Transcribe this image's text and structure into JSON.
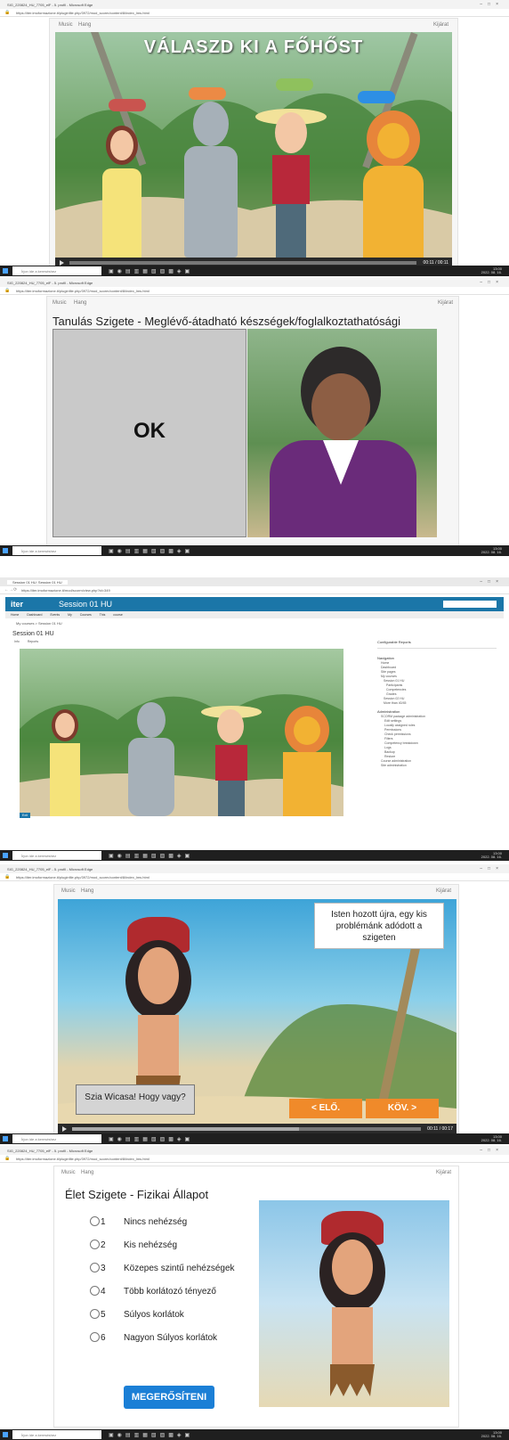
{
  "shot1": {
    "window_title": "SIG_220824_HU_7705_elF - 5. profil - Microsoft Edge",
    "url": "https://iter.imoformazione.it/pluginfile.php/3972/mod_scorm/content/8/index_lms.html",
    "menu_music": "Music",
    "menu_sound": "Hang",
    "exit": "Kijárat",
    "headline": "VÁLASZD KI A FŐHŐST",
    "time": "00:11 / 00:11"
  },
  "shot2": {
    "window_title": "SIG_220824_HU_7705_elF - 5. profil - Microsoft Edge",
    "url": "https://iter.imoformazione.it/pluginfile.php/3972/mod_scorm/content/8/index_lms.html",
    "menu_music": "Music",
    "menu_sound": "Hang",
    "exit": "Kijárat",
    "title": "Tanulás Szigete - Meglévő-átadható készségek/foglalkoztathatósági",
    "ok": "OK"
  },
  "shot3": {
    "tab_title": "Session 01 HU: Session 01 HU",
    "url": "https://iter.imoformazione.it/mod/scorm/view.php?id=349",
    "site_logo": "iter",
    "course_title": "Session 01 HU",
    "nav_items": [
      "Home",
      "Dashboard",
      "Events",
      "My Courses",
      "This course"
    ],
    "breadcrumb": "My courses  >  Session 01 HU",
    "page_heading": "Session 01 HU",
    "tabs": [
      "Info",
      "Reports"
    ],
    "block_reports": "Configurable Reports",
    "block_navigation": "Navigation",
    "nav_tree": [
      "Home",
      "Dashboard",
      "Site pages",
      "My courses",
      "Session 01 HU",
      "Participants",
      "Competencies",
      "Grades",
      "Session 02 HU",
      "More than 40/45"
    ],
    "block_admin": "Administration",
    "admin_tree": [
      "SCORM package administration",
      "Edit settings",
      "Locally assigned roles",
      "Permissions",
      "Check permissions",
      "Filters",
      "Competency breakdown",
      "Logs",
      "Backup",
      "Restore",
      "Course administration",
      "Site administration"
    ],
    "exit_btn": "Exit"
  },
  "shot4": {
    "window_title": "SIG_220824_HU_7705_elF - 5. profil - Microsoft Edge",
    "url": "https://iter.imoformazione.it/pluginfile.php/3972/mod_scorm/content/8/index_lms.html",
    "menu_music": "Music",
    "menu_sound": "Hang",
    "exit": "Kijárat",
    "bubble_top": "Isten hozott újra, egy kis problémánk adódott a szigeten",
    "bubble_bottom": "Szia Wicasa! Hogy vagy?",
    "btn_prev": "< ELŐ.",
    "btn_next": "KÖV. >",
    "time": "00:11 / 00:17"
  },
  "shot5": {
    "window_title": "SIG_220824_HU_7705_elF - 5. profil - Microsoft Edge",
    "url": "https://iter.imoformazione.it/pluginfile.php/3972/mod_scorm/content/8/index_lms.html",
    "menu_music": "Music",
    "menu_sound": "Hang",
    "exit": "Kijárat",
    "title": "Élet Szigete - Fizikai Állapot",
    "options": [
      {
        "num": "1",
        "label": "Nincs nehézség"
      },
      {
        "num": "2",
        "label": "Kis nehézség"
      },
      {
        "num": "3",
        "label": "Közepes szintű nehézségek"
      },
      {
        "num": "4",
        "label": "Több korlátozó tényező"
      },
      {
        "num": "5",
        "label": "Súlyos korlátok"
      },
      {
        "num": "6",
        "label": "Nagyon Súlyos korlátok"
      }
    ],
    "confirm": "MEGERŐSÍTENI"
  },
  "taskbar": {
    "search_placeholder": "Írjon ide a kereséshez",
    "clock": "13:00",
    "date": "2022. 08. 16."
  },
  "colors": {
    "green_bg": "#4d8f3a",
    "moodle_blue": "#1b76a8",
    "orange_btn": "#f08a2a",
    "confirm_blue": "#1b7fd6"
  }
}
